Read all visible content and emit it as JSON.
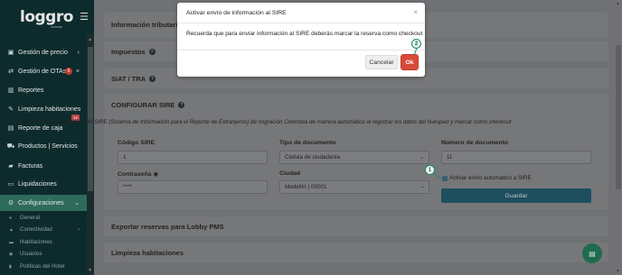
{
  "sidebar": {
    "logo": "loggro",
    "logo_sub": "restobar",
    "items": [
      {
        "label": "Gestión de precio",
        "icon": "money-icon",
        "arrow": "‹"
      },
      {
        "label": "Gestión de OTAs",
        "icon": "exchange-icon",
        "badge": "6"
      },
      {
        "label": "Reportes",
        "icon": "chart-icon"
      },
      {
        "label": "Limpieza habitaciones",
        "icon": "broom-icon"
      },
      {
        "label": "Reporte de caja",
        "icon": "cashbox-icon",
        "badge": "12"
      },
      {
        "label": "Productos | Servicios",
        "icon": "cart-icon"
      },
      {
        "label": "Facturas",
        "icon": "truck-icon"
      },
      {
        "label": "Liquidaciones",
        "icon": "card-icon"
      },
      {
        "label": "Configuraciones",
        "icon": "gear-icon",
        "arrow": "⌄"
      }
    ],
    "subitems": [
      {
        "label": "General",
        "icon": "dot-icon"
      },
      {
        "label": "Conectividad",
        "icon": "signal-icon",
        "arrow": "‹"
      },
      {
        "label": "Habitaciones",
        "icon": "bed-icon"
      },
      {
        "label": "Usuarios",
        "icon": "users-icon"
      },
      {
        "label": "Políticas del Hotel",
        "icon": "book-icon"
      }
    ]
  },
  "panels": {
    "info": "Información tributaria",
    "impuestos": "Impuestos",
    "siat": "SIAT / TRA",
    "sire": "CONFIGURAR SIRE",
    "exportar": "Exportar reservas para Lobby PMS",
    "limpieza": "Limpieza habitaciones"
  },
  "sire": {
    "description": "Diligenciamiento automático del SIRE (Sistema de Información para el Reporte de Extranjeros) de migración Colombia de manera automática al registrar los datos del huésped y marcar como checkout",
    "codigo_label": "Código SIRE",
    "codigo_value": "1",
    "tipo_label": "Tipo de documento",
    "tipo_value": "Cédula de ciudadanía",
    "numero_label": "Número de documento",
    "numero_value": "11",
    "password_label": "Contraseña",
    "password_value": "****",
    "ciudad_label": "Ciudad",
    "ciudad_value": "Medellín | 05001",
    "checkbox_label": "Activar envío automatico a SIRE",
    "save_label": "Guardar"
  },
  "modal": {
    "title": "Activar envío de información al SIRE",
    "close": "×",
    "body": "Recuerda que para enviar información al SIRE deberás marcar la reserva como checkout",
    "cancel_label": "Cancelar",
    "ok_label": "Ok"
  },
  "callouts": {
    "one": "1",
    "two": "2"
  },
  "colors": {
    "sidebar_bg": "#0d2b2c",
    "active": "#2f6b5b",
    "ok_button": "#d84a38",
    "save_button": "#1e4f5e",
    "callout": "#1f8a6c"
  }
}
